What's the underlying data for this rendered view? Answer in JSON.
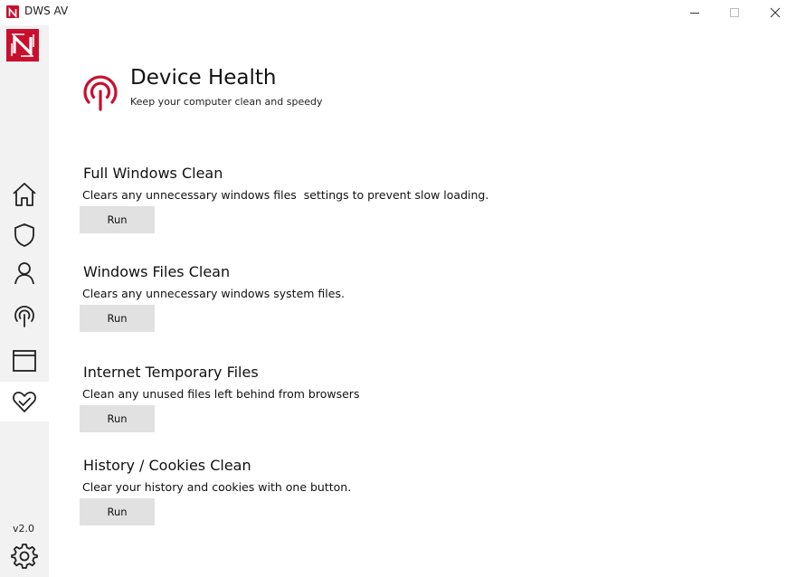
{
  "window": {
    "title": "DWS AV",
    "controls": [
      "minimize-icon",
      "maximize-icon",
      "close-icon"
    ]
  },
  "colors": {
    "brand": "#c8102e",
    "sidebar_bg": "#f2f2f2",
    "button_bg": "#e1e1e1",
    "active_nav_bg": "#ffffff"
  },
  "sidebar": {
    "logo_icon": "dws-logo-icon",
    "items": [
      {
        "id": "home",
        "icon": "home-icon",
        "active": false
      },
      {
        "id": "protection",
        "icon": "shield-icon",
        "active": false
      },
      {
        "id": "account",
        "icon": "user-icon",
        "active": false
      },
      {
        "id": "network",
        "icon": "broadcast-icon",
        "active": false
      },
      {
        "id": "browser",
        "icon": "browser-window-icon",
        "active": false
      },
      {
        "id": "health",
        "icon": "heart-check-icon",
        "active": true
      }
    ],
    "version": "v2.0",
    "settings_icon": "gear-icon"
  },
  "header": {
    "icon": "broadcast-icon",
    "title": "Device Health",
    "subtitle": "Keep your computer clean and  speedy"
  },
  "sections": [
    {
      "title": "Full Windows Clean",
      "description": "Clears any unnecessary windows files  settings to prevent slow loading.",
      "button": "Run"
    },
    {
      "title": "Windows Files Clean",
      "description": "Clears any unnecessary windows system files.",
      "button": "Run"
    },
    {
      "title": "Internet Temporary Files",
      "description": "Clean any unused files left behind from browsers",
      "button": "Run"
    },
    {
      "title": "History / Cookies Clean",
      "description": "Clear your history and cookies with one button.",
      "button": "Run"
    }
  ]
}
